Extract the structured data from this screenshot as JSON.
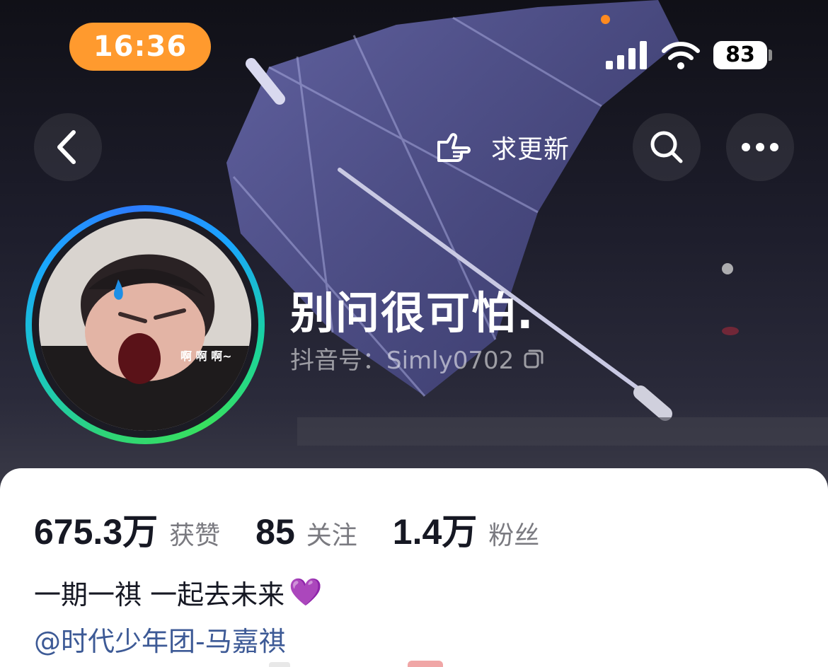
{
  "status_bar": {
    "time": "16:36",
    "battery": "83",
    "signal_icon": "cellular-signal-icon",
    "wifi_icon": "wifi-icon"
  },
  "nav": {
    "back_icon": "chevron-left-icon",
    "request_update_label": "求更新",
    "request_update_icon": "pointing-hand-icon",
    "search_icon": "search-icon",
    "more_icon": "more-dots-icon"
  },
  "profile": {
    "nickname": "别问很可怕.",
    "douyin_id": "抖音号：Simly0702",
    "avatar_overlay_text": "啊 啊 啊~"
  },
  "stats": [
    {
      "value": "675.3万",
      "label": "获赞"
    },
    {
      "value": "85",
      "label": "关注"
    },
    {
      "value": "1.4万",
      "label": "粉丝"
    }
  ],
  "bio": {
    "text": "一期一祺 一起去未来",
    "emoji": "💜",
    "mention": "@时代少年团-马嘉祺"
  },
  "colors": {
    "time_pill": "#ff9a2e",
    "mention": "#3d5a96",
    "ring_green": "#2ed477",
    "ring_blue": "#1aa6ff"
  }
}
